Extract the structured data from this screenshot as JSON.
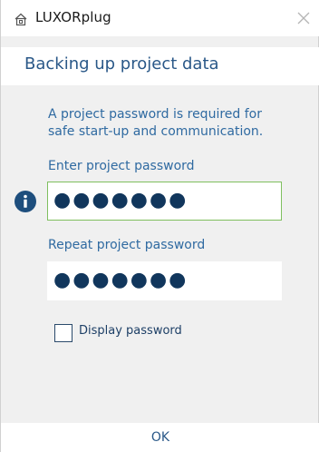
{
  "window": {
    "app_title": "LUXORplug",
    "icon_name": "home-device-icon",
    "close_icon": "close-icon"
  },
  "header": {
    "title": "Backing up project data"
  },
  "content": {
    "info_text": "A project password is required for safe start-up and communication.",
    "password_label": "Enter project password",
    "password_value": "●●●●●●●",
    "repeat_label": "Repeat project password",
    "repeat_value": "●●●●●●●",
    "display_password_label": "Display password",
    "display_password_checked": false,
    "info_icon": "info-icon"
  },
  "footer": {
    "ok_label": "OK"
  },
  "colors": {
    "accent": "#2a5888",
    "focus_border": "#7fbf5f",
    "info_icon_bg": "#1e4e7d"
  }
}
